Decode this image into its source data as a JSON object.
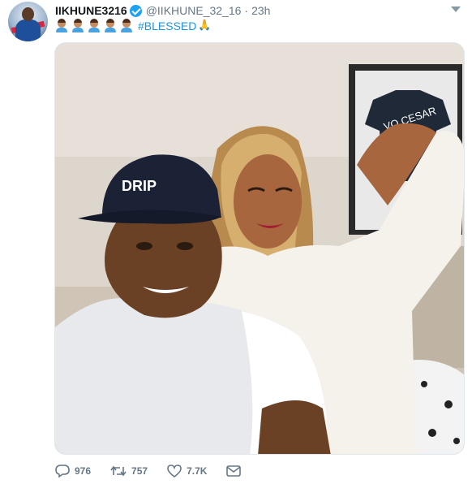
{
  "tweet": {
    "display_name": "IIKHUNE3216",
    "handle": "@IIKHUNE_32_16",
    "separator": "·",
    "time": "23h",
    "hashtag": "#BLESSED",
    "pray_emoji": "🙏",
    "emoji_count": 5
  },
  "photo": {
    "cap_text": "DRIP",
    "frame_text": "VO CESAR"
  },
  "actions": {
    "reply_count": "976",
    "retweet_count": "757",
    "like_count": "7.7K"
  },
  "colors": {
    "verified": "#1da1f2",
    "hashtag": "#1b95e0",
    "muted": "#657786"
  },
  "icons": [
    "verified-icon",
    "caret-down-icon",
    "reply-icon",
    "retweet-icon",
    "like-icon",
    "message-icon"
  ]
}
